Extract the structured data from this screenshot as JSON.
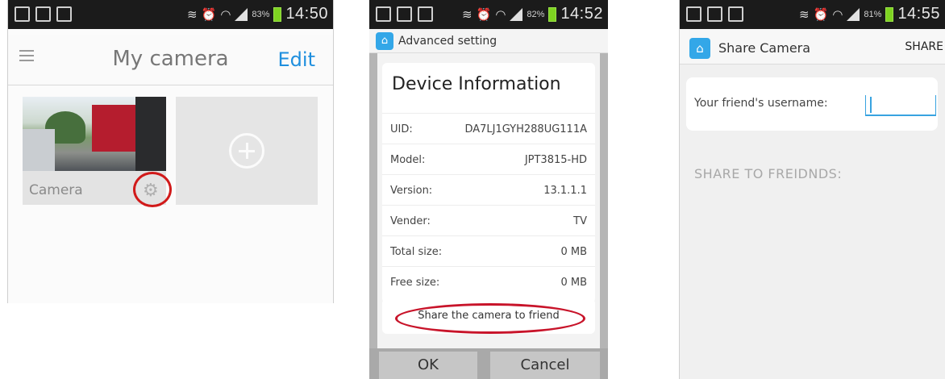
{
  "screen1": {
    "status": {
      "battery": "83%",
      "time": "14:50"
    },
    "header": {
      "title": "My camera",
      "edit_label": "Edit"
    },
    "camera_card": {
      "label": "Camera"
    }
  },
  "screen2": {
    "status": {
      "battery": "82%",
      "time": "14:52"
    },
    "top_title": "Advanced setting",
    "device_info": {
      "title": "Device Information",
      "rows": [
        {
          "key": "UID:",
          "value": "DA7LJ1GYH288UG111A"
        },
        {
          "key": "Model:",
          "value": "JPT3815-HD"
        },
        {
          "key": "Version:",
          "value": "13.1.1.1"
        },
        {
          "key": "Vender:",
          "value": "TV"
        },
        {
          "key": "Total size:",
          "value": "0 MB"
        },
        {
          "key": "Free size:",
          "value": "0 MB"
        }
      ]
    },
    "share_button": "Share the camera to friend",
    "ok_label": "OK",
    "cancel_label": "Cancel"
  },
  "screen3": {
    "status": {
      "battery": "81%",
      "time": "14:55"
    },
    "top_title": "Share Camera",
    "share_label": "SHARE",
    "username_label": "Your friend's username:",
    "username_value": "",
    "section_title": "SHARE TO FREIDNDS:"
  },
  "colors": {
    "accent": "#1f8fde",
    "highlight_ring": "#d11a1a",
    "battery": "#7ed321"
  },
  "icons": [
    "gallery-icon",
    "sim-icon",
    "bag-icon",
    "vibrate-icon",
    "alarm-icon",
    "wifi-icon",
    "signal-icon",
    "battery-icon",
    "menu-icon",
    "gear-icon",
    "plus-icon",
    "app-home-icon"
  ]
}
